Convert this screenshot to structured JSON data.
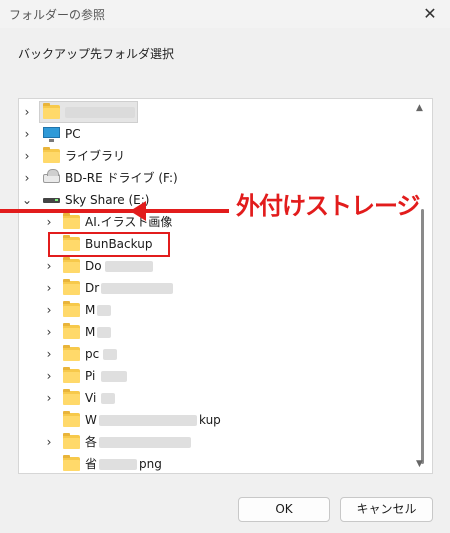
{
  "window": {
    "title": "フォルダーの参照",
    "close_label": "✕"
  },
  "instruction": "バックアップ先フォルダ選択",
  "tree": {
    "items": [
      {
        "label": "",
        "chevron": "›",
        "icon": "folder-icon"
      },
      {
        "label": "PC",
        "chevron": "›",
        "icon": "pc-icon"
      },
      {
        "label": "ライブラリ",
        "chevron": "›",
        "icon": "folder-icon"
      },
      {
        "label": "BD-RE ドライブ (F:)",
        "chevron": "›",
        "icon": "bd-drive-icon"
      },
      {
        "label": "Sky Share (E:)",
        "chevron": "⌄",
        "icon": "drive-icon"
      },
      {
        "label": "AI.イラスト画像",
        "chevron": "›",
        "icon": "folder-icon"
      },
      {
        "label": "BunBackup",
        "chevron": "",
        "icon": "folder-icon"
      },
      {
        "label": "Do",
        "chevron": "›",
        "icon": "folder-icon"
      },
      {
        "label": "Dr",
        "chevron": "›",
        "icon": "folder-icon"
      },
      {
        "label": "M",
        "chevron": "›",
        "icon": "folder-icon"
      },
      {
        "label": "M",
        "chevron": "›",
        "icon": "folder-icon"
      },
      {
        "label": "pc",
        "chevron": "›",
        "icon": "folder-icon"
      },
      {
        "label": "Pi",
        "chevron": "›",
        "icon": "folder-icon"
      },
      {
        "label": "Vi",
        "chevron": "›",
        "icon": "folder-icon"
      },
      {
        "label": "W",
        "chevron": "",
        "icon": "folder-icon",
        "suffix": "kup"
      },
      {
        "label": "各",
        "chevron": "›",
        "icon": "folder-icon"
      },
      {
        "label": "省",
        "chevron": "",
        "icon": "folder-icon",
        "suffix": "png"
      }
    ]
  },
  "annotation": {
    "text": "外付けストレージ",
    "color": "#e21c1c"
  },
  "buttons": {
    "ok": "OK",
    "cancel": "キャンセル"
  }
}
